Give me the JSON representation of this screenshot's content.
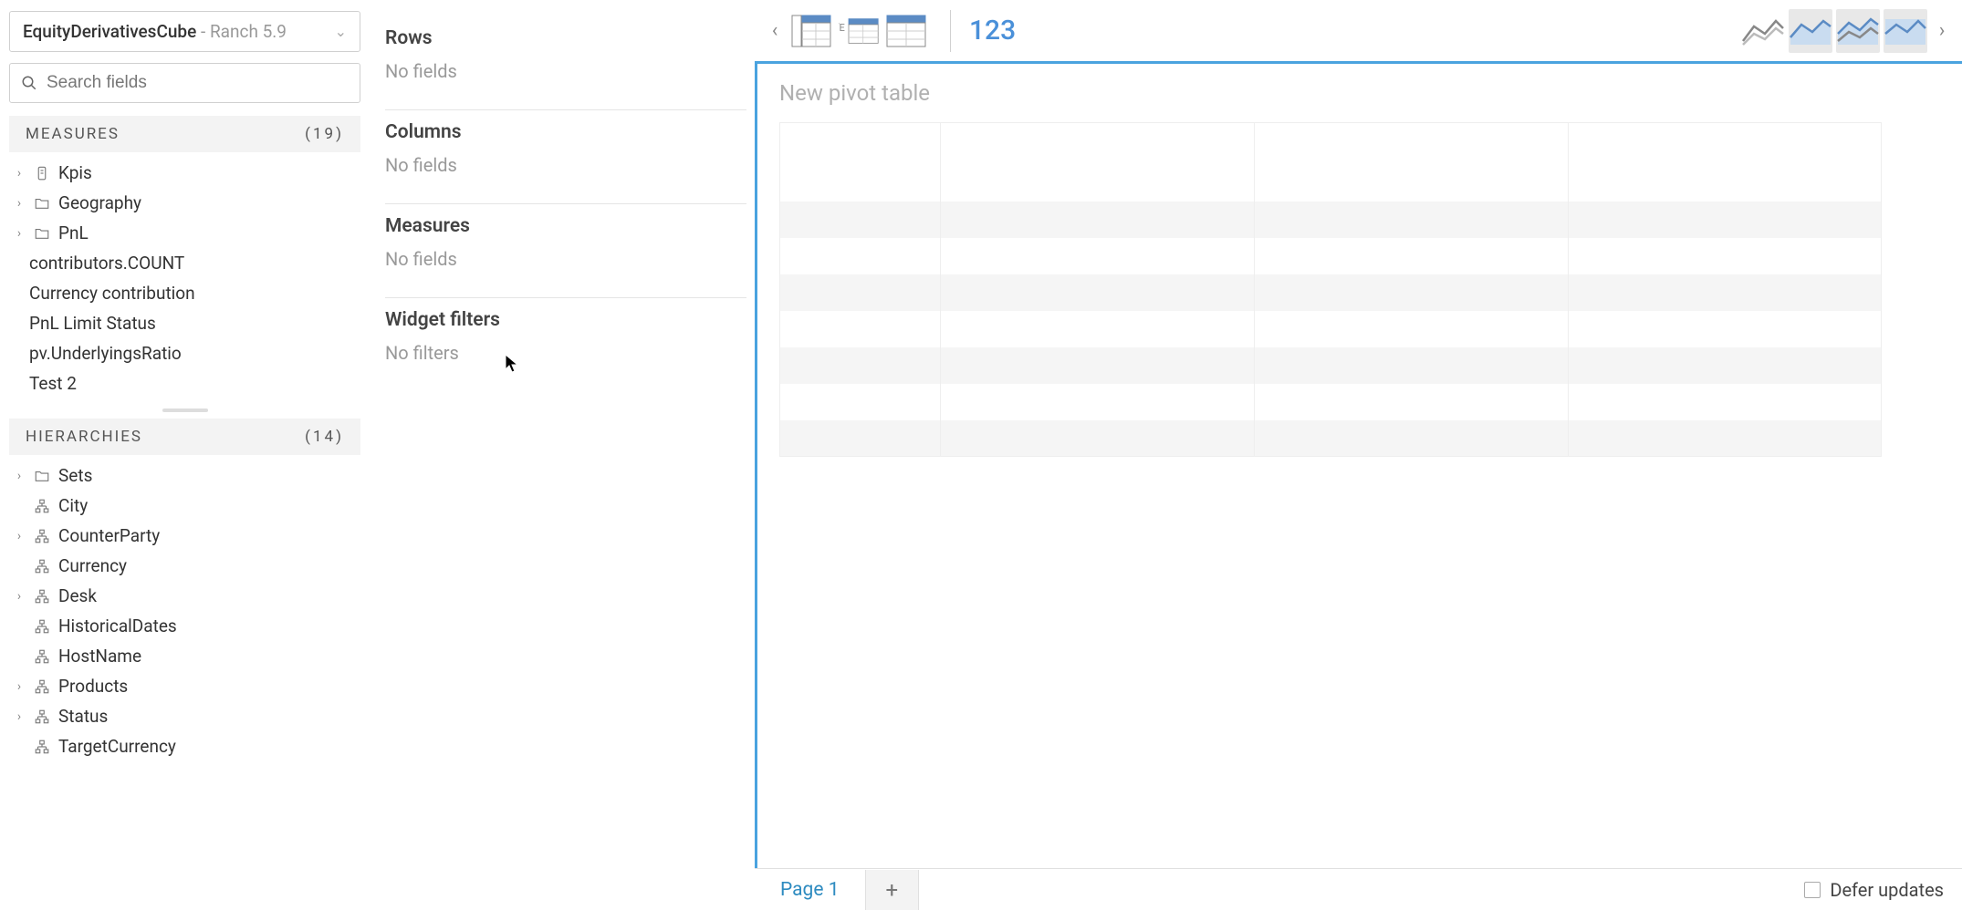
{
  "cube": {
    "name": "EquityDerivativesCube",
    "version": "- Ranch 5.9"
  },
  "search": {
    "placeholder": "Search fields"
  },
  "sections": {
    "measures": {
      "title": "MEASURES",
      "count": "(19)",
      "items": [
        {
          "label": "Kpis",
          "expandable": true,
          "icon": "kpi"
        },
        {
          "label": "Geography",
          "expandable": true,
          "icon": "folder"
        },
        {
          "label": "PnL",
          "expandable": true,
          "icon": "folder"
        },
        {
          "label": "contributors.COUNT",
          "expandable": false,
          "icon": ""
        },
        {
          "label": "Currency contribution",
          "expandable": false,
          "icon": ""
        },
        {
          "label": "PnL Limit Status",
          "expandable": false,
          "icon": ""
        },
        {
          "label": "pv.UnderlyingsRatio",
          "expandable": false,
          "icon": ""
        },
        {
          "label": "Test 2",
          "expandable": false,
          "icon": ""
        }
      ]
    },
    "hierarchies": {
      "title": "HIERARCHIES",
      "count": "(14)",
      "items": [
        {
          "label": "Sets",
          "expandable": true,
          "icon": "folder"
        },
        {
          "label": "City",
          "expandable": false,
          "icon": "hier"
        },
        {
          "label": "CounterParty",
          "expandable": true,
          "icon": "hier"
        },
        {
          "label": "Currency",
          "expandable": false,
          "icon": "hier"
        },
        {
          "label": "Desk",
          "expandable": true,
          "icon": "hier"
        },
        {
          "label": "HistoricalDates",
          "expandable": false,
          "icon": "hier-date"
        },
        {
          "label": "HostName",
          "expandable": false,
          "icon": "hier"
        },
        {
          "label": "Products",
          "expandable": true,
          "icon": "hier"
        },
        {
          "label": "Status",
          "expandable": true,
          "icon": "hier"
        },
        {
          "label": "TargetCurrency",
          "expandable": false,
          "icon": "hier"
        }
      ]
    }
  },
  "zones": {
    "rows": {
      "title": "Rows",
      "empty": "No fields"
    },
    "columns": {
      "title": "Columns",
      "empty": "No fields"
    },
    "measures": {
      "title": "Measures",
      "empty": "No fields"
    },
    "filters": {
      "title": "Widget filters",
      "empty": "No filters"
    }
  },
  "canvas": {
    "title": "New pivot table"
  },
  "kpi_button": "123",
  "tabs": {
    "page1": "Page 1",
    "add": "+"
  },
  "defer_label": "Defer updates"
}
